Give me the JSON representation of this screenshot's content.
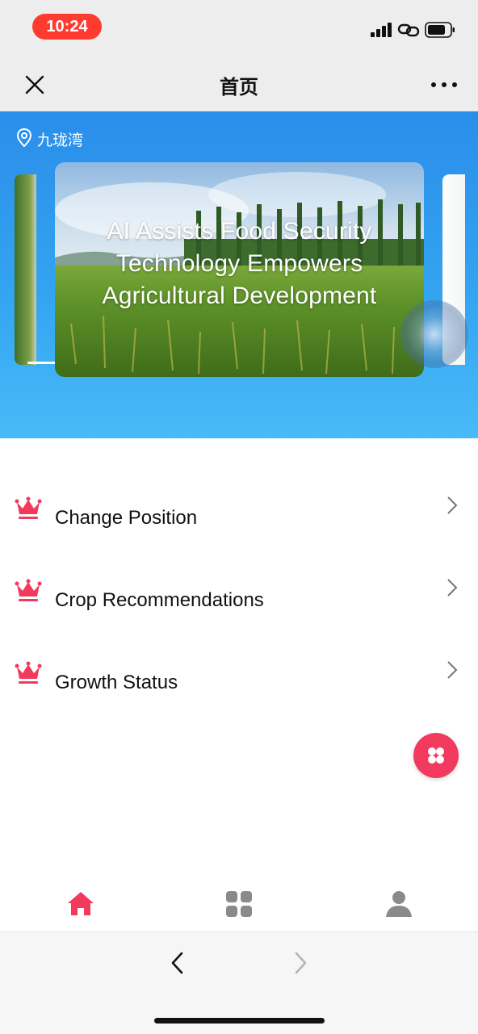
{
  "status_bar": {
    "time": "10:24"
  },
  "nav": {
    "title": "首页",
    "close_icon": "close-icon",
    "more_icon": "more-icon"
  },
  "header": {
    "location_icon": "location-pin-icon",
    "location": "九珑湾",
    "banner": {
      "line1": "AI Assists Food Security",
      "line2": "Technology Empowers",
      "line3": "Agricultural Development"
    }
  },
  "menu": [
    {
      "label": "Change Position",
      "icon": "crown-icon"
    },
    {
      "label": "Crop Recommendations",
      "icon": "crown-icon"
    },
    {
      "label": "Growth Status",
      "icon": "crown-icon"
    }
  ],
  "fab_icon": "four-petal-menu-icon",
  "tabs": [
    {
      "name": "home",
      "icon": "home-icon",
      "active": true
    },
    {
      "name": "apps",
      "icon": "grid-icon",
      "active": false
    },
    {
      "name": "profile",
      "icon": "user-icon",
      "active": false
    }
  ],
  "colors": {
    "accent": "#f23a5f",
    "header_blue": "#2a8eea",
    "status_pill": "#ff3b30",
    "inactive_tab": "#8a8a8a"
  }
}
